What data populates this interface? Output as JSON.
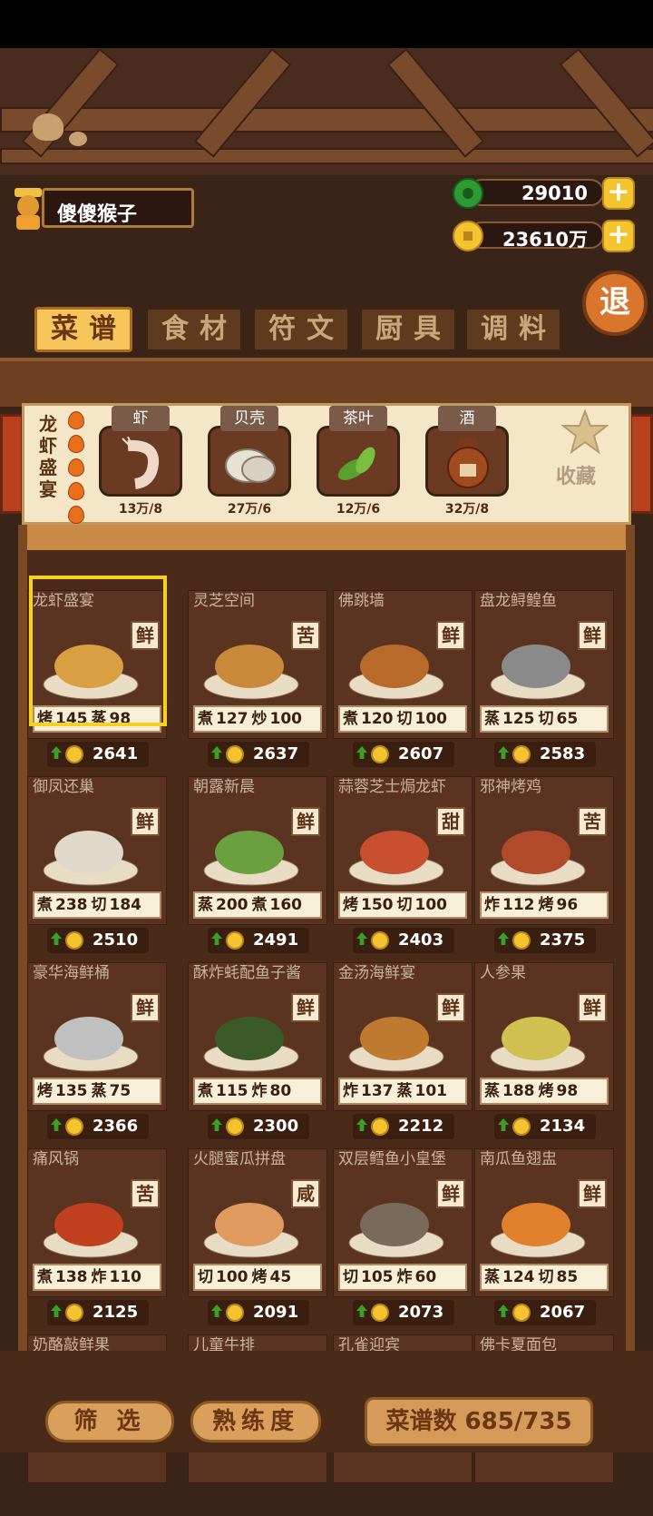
{
  "player": {
    "name": "傻傻猴子"
  },
  "currency": {
    "jade": "29010",
    "coins": "23610万"
  },
  "exit_label": "退",
  "tabs": [
    "菜谱",
    "食材",
    "符文",
    "厨具",
    "调料"
  ],
  "active_tab": 0,
  "detail": {
    "dish_name": "龙虾盛宴",
    "flames": 5,
    "ingredients": [
      {
        "name": "虾",
        "count": "13万/8",
        "icon": "shrimp-icon"
      },
      {
        "name": "贝壳",
        "count": "27万/6",
        "icon": "shell-icon"
      },
      {
        "name": "茶叶",
        "count": "12万/6",
        "icon": "tea-leaf-icon"
      },
      {
        "name": "酒",
        "count": "32万/8",
        "icon": "wine-jar-icon"
      }
    ],
    "favorite_label": "收藏"
  },
  "recipes": [
    {
      "name": "龙虾盛宴",
      "taste": "鲜",
      "skills": [
        "烤",
        "145",
        "蒸",
        "98"
      ],
      "price": "2641",
      "selected": true
    },
    {
      "name": "灵芝空间",
      "taste": "苦",
      "skills": [
        "煮",
        "127",
        "炒",
        "100"
      ],
      "price": "2637"
    },
    {
      "name": "佛跳墙",
      "taste": "鲜",
      "skills": [
        "煮",
        "120",
        "切",
        "100"
      ],
      "price": "2607"
    },
    {
      "name": "盘龙鲟鳇鱼",
      "taste": "鲜",
      "skills": [
        "蒸",
        "125",
        "切",
        "65"
      ],
      "price": "2583"
    },
    {
      "name": "御凤还巢",
      "taste": "鲜",
      "skills": [
        "煮",
        "238",
        "切",
        "184"
      ],
      "price": "2510"
    },
    {
      "name": "朝露新晨",
      "taste": "鲜",
      "skills": [
        "蒸",
        "200",
        "煮",
        "160"
      ],
      "price": "2491"
    },
    {
      "name": "蒜蓉芝士焗龙虾",
      "taste": "甜",
      "skills": [
        "烤",
        "150",
        "切",
        "100"
      ],
      "price": "2403"
    },
    {
      "name": "邪神烤鸡",
      "taste": "苦",
      "skills": [
        "炸",
        "112",
        "烤",
        "96"
      ],
      "price": "2375"
    },
    {
      "name": "豪华海鲜桶",
      "taste": "鲜",
      "skills": [
        "烤",
        "135",
        "蒸",
        "75"
      ],
      "price": "2366"
    },
    {
      "name": "酥炸蚝配鱼子酱",
      "taste": "鲜",
      "skills": [
        "煮",
        "115",
        "炸",
        "80"
      ],
      "price": "2300"
    },
    {
      "name": "金汤海鲜宴",
      "taste": "鲜",
      "skills": [
        "炸",
        "137",
        "蒸",
        "101"
      ],
      "price": "2212"
    },
    {
      "name": "人参果",
      "taste": "鲜",
      "skills": [
        "蒸",
        "188",
        "烤",
        "98"
      ],
      "price": "2134"
    },
    {
      "name": "痛风锅",
      "taste": "苦",
      "skills": [
        "煮",
        "138",
        "炸",
        "110"
      ],
      "price": "2125"
    },
    {
      "name": "火腿蜜瓜拼盘",
      "taste": "咸",
      "skills": [
        "切",
        "100",
        "烤",
        "45"
      ],
      "price": "2091"
    },
    {
      "name": "双层鳕鱼小皇堡",
      "taste": "鲜",
      "skills": [
        "切",
        "105",
        "炸",
        "60"
      ],
      "price": "2073"
    },
    {
      "name": "南瓜鱼翅盅",
      "taste": "鲜",
      "skills": [
        "蒸",
        "124",
        "切",
        "85"
      ],
      "price": "2067"
    },
    {
      "name": "奶酪敲鲜果",
      "taste": "",
      "skills": [
        "",
        "",
        "",
        ""
      ],
      "price": "",
      "partial": true
    },
    {
      "name": "儿童牛排",
      "taste": "",
      "skills": [
        "",
        "",
        "",
        ""
      ],
      "price": "",
      "partial": true
    },
    {
      "name": "孔雀迎宾",
      "taste": "",
      "skills": [
        "",
        "",
        "",
        ""
      ],
      "price": "",
      "partial": true
    },
    {
      "name": "佛卡夏面包",
      "taste": "",
      "skills": [
        "",
        "",
        "",
        ""
      ],
      "price": "",
      "partial": true
    }
  ],
  "bottom": {
    "filter_label": "筛 选",
    "proficiency_label": "熟练度",
    "recipe_count_label": "菜谱数",
    "recipe_count": "685/735"
  },
  "colors": {
    "active_tab": "#f6c65a",
    "taste_badge": "#f6ead2",
    "coin": "#f4c430",
    "jade": "#2e9a34"
  }
}
